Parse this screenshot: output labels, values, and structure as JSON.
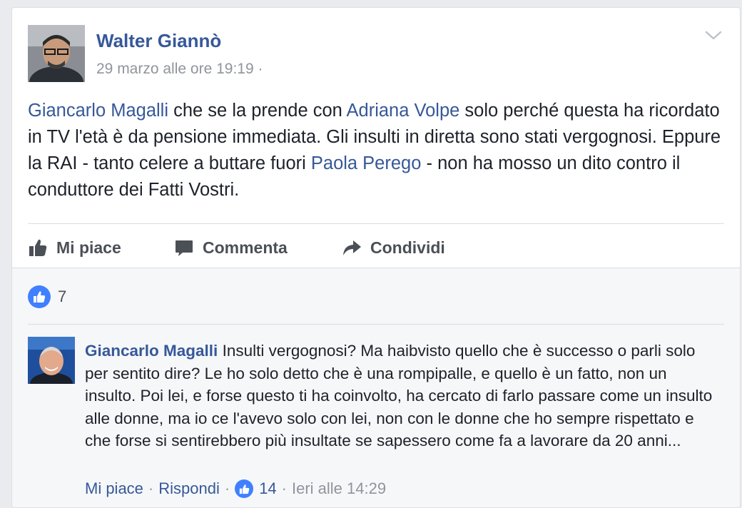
{
  "post": {
    "author": "Walter Giannò",
    "timestamp": "29 marzo alle ore 19:19",
    "separator": " ·",
    "text": {
      "m1": "Giancarlo Magalli",
      "t1": " che se la prende con ",
      "m2": "Adriana Volpe",
      "t2": " solo perché questa ha ricordato in TV l'età è da pensione immediata. Gli insulti in diretta sono stati vergognosi. Eppure la RAI - tanto celere a buttare fuori ",
      "m3": "Paola Perego",
      "t3": " - non ha mosso un dito contro il conduttore dei Fatti Vostri."
    },
    "actions": {
      "like": "Mi piace",
      "comment": "Commenta",
      "share": "Condividi"
    },
    "like_count": "7"
  },
  "comment": {
    "author": "Giancarlo Magalli",
    "text": " Insulti vergognosi? Ma haibvisto quello che è successo o parli solo per sentito dire? Le ho solo detto che è una rompipalle, e quello è un fatto, non un insulto. Poi lei, e forse questo ti ha coinvolto, ha cercato di farlo passare come un insulto alle donne, ma io ce l'avevo solo con lei, non con le donne che ho sempre rispettato e che forse si sentirebbero più insultate se sapessero come fa a lavorare da 20 anni...",
    "like_label": "Mi piace",
    "reply_label": "Rispondi",
    "like_count": "14",
    "time": "Ieri alle 14:29",
    "dot": "·"
  },
  "colors": {
    "link": "#365899",
    "meta": "#90949c",
    "like_blue": "#4080ff",
    "action_grey": "#4b4f56"
  },
  "icons": [
    "chevron-down-icon",
    "thumbs-up-icon",
    "comment-bubble-icon",
    "share-arrow-icon",
    "like-badge-icon"
  ]
}
